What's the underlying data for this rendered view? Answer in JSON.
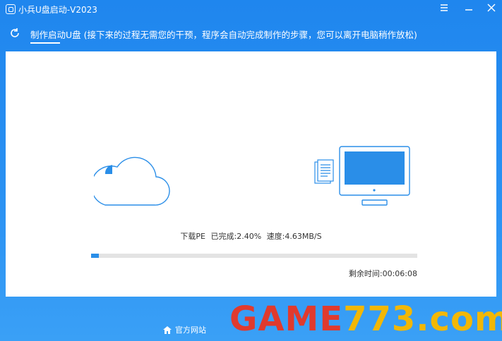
{
  "window": {
    "title": "小兵U盘启动-V2023",
    "controls": [
      "menu-icon",
      "minimize-icon",
      "close-icon"
    ]
  },
  "header": {
    "subtitle": "制作启动U盘 (接下来的过程无需您的干预，程序会自动完成制作的步骤，您可以离开电脑稍作放松)"
  },
  "progress": {
    "task_label": "下载PE",
    "completed_text": "已完成:2.40%",
    "speed_text": "速度:4.63MB/S",
    "percent": 2.4,
    "remaining_text": "剩余时间:00:06:08"
  },
  "footer": {
    "official_site_label": "官方网站"
  },
  "watermark": {
    "part1": "GAME",
    "part2": "773.com"
  },
  "colors": {
    "brand_blue": "#1f86ee",
    "progress_blue": "#2a8ee8",
    "track_gray": "#e3e3e3"
  }
}
